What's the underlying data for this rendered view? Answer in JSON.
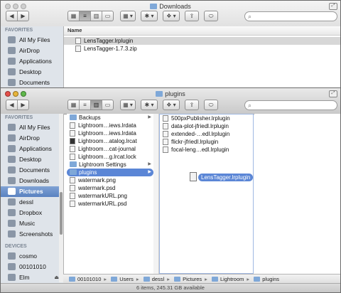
{
  "back_window": {
    "title": "Downloads",
    "search_placeholder": "",
    "sidebar_heading": "FAVORITES",
    "sidebar_items": [
      {
        "label": "All My Files",
        "icon": "all-files-icon"
      },
      {
        "label": "AirDrop",
        "icon": "airdrop-icon"
      },
      {
        "label": "Applications",
        "icon": "applications-icon"
      },
      {
        "label": "Desktop",
        "icon": "desktop-icon"
      },
      {
        "label": "Documents",
        "icon": "documents-icon"
      }
    ],
    "list_header": "Name",
    "files": [
      {
        "name": "LensTagger.lrplugin",
        "selected": true
      },
      {
        "name": "LensTagger-1.7.3.zip",
        "selected": false
      }
    ]
  },
  "front_window": {
    "title": "plugins",
    "sidebar": {
      "favorites_heading": "FAVORITES",
      "favorites": [
        {
          "label": "All My Files",
          "icon": "all-files-icon"
        },
        {
          "label": "AirDrop",
          "icon": "airdrop-icon"
        },
        {
          "label": "Applications",
          "icon": "applications-icon"
        },
        {
          "label": "Desktop",
          "icon": "desktop-icon"
        },
        {
          "label": "Documents",
          "icon": "documents-icon"
        },
        {
          "label": "Downloads",
          "icon": "downloads-icon"
        },
        {
          "label": "Pictures",
          "icon": "camera-icon",
          "selected": true
        },
        {
          "label": "dessl",
          "icon": "home-icon"
        },
        {
          "label": "Dropbox",
          "icon": "dropbox-icon"
        },
        {
          "label": "Music",
          "icon": "music-icon"
        },
        {
          "label": "Screenshots",
          "icon": "folder-icon"
        }
      ],
      "devices_heading": "DEVICES",
      "devices": [
        {
          "label": "cosmo",
          "icon": "computer-icon"
        },
        {
          "label": "00101010",
          "icon": "disk-icon"
        },
        {
          "label": "Elm",
          "icon": "disk-icon",
          "eject": "⏏"
        }
      ]
    },
    "column1": [
      {
        "name": "Backups",
        "type": "folder",
        "arrow": true
      },
      {
        "name": "Lightroom…iews.lrdata",
        "type": "file"
      },
      {
        "name": "Lightroom…iews.lrdata",
        "type": "file"
      },
      {
        "name": "Lightroom…atalog.lrcat",
        "type": "file"
      },
      {
        "name": "Lightroom…cat-journal",
        "type": "file"
      },
      {
        "name": "Lightroom…g.lrcat.lock",
        "type": "file"
      },
      {
        "name": "Lightroom Settings",
        "type": "folder",
        "arrow": true
      },
      {
        "name": "plugins",
        "type": "folder",
        "arrow": true,
        "selected": true
      },
      {
        "name": "watermark.png",
        "type": "file"
      },
      {
        "name": "watermark.psd",
        "type": "file"
      },
      {
        "name": "watermarkURL.png",
        "type": "file"
      },
      {
        "name": "watermarkURL.psd",
        "type": "file"
      }
    ],
    "column2": [
      {
        "name": "500pxPublisher.lrplugin"
      },
      {
        "name": "data-plot-jfriedl.lrplugin"
      },
      {
        "name": "extended-…edl.lrplugin"
      },
      {
        "name": "flickr-jfriedl.lrplugin"
      },
      {
        "name": "focal-leng…edl.lrplugin"
      }
    ],
    "drag_item": "LensTagger.lrplugin",
    "path": [
      "00101010",
      "Users",
      "dessl",
      "Pictures",
      "Lightroom",
      "plugins"
    ],
    "path_separator": "▸",
    "status": "6 items, 245.31 GB available"
  },
  "toolbar": {
    "back": "◀",
    "forward": "▶",
    "view_icons": [
      "▦",
      "≡",
      "▥",
      "▭"
    ],
    "arrange": "▦ ▾",
    "action": "✱ ▾",
    "dropbox": "❖ ▾",
    "share": "⇪",
    "tag": "⬭"
  },
  "colors": {
    "selection": "#5b86d6",
    "sidebar_bg": "#dfe4ea",
    "folder": "#7fa8d8"
  }
}
